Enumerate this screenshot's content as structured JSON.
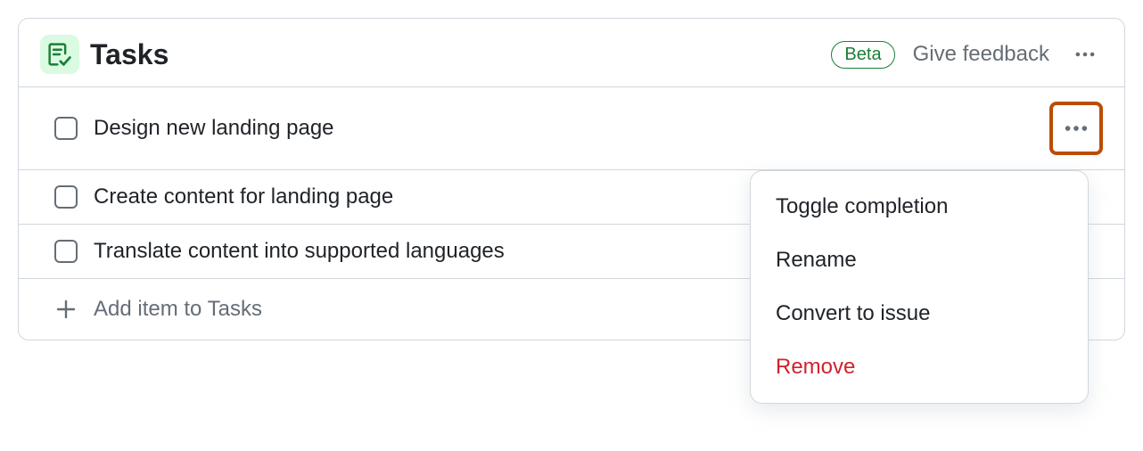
{
  "header": {
    "title": "Tasks",
    "badge": "Beta",
    "feedback": "Give feedback"
  },
  "tasks": [
    {
      "title": "Design new landing page"
    },
    {
      "title": "Create content for landing page"
    },
    {
      "title": "Translate content into supported languages"
    }
  ],
  "add_label": "Add item to Tasks",
  "menu": {
    "toggle": "Toggle completion",
    "rename": "Rename",
    "convert": "Convert to issue",
    "remove": "Remove"
  },
  "colors": {
    "accent_green": "#1a7f37",
    "highlight_orange": "#bc4c00",
    "danger_red": "#cf222e"
  }
}
